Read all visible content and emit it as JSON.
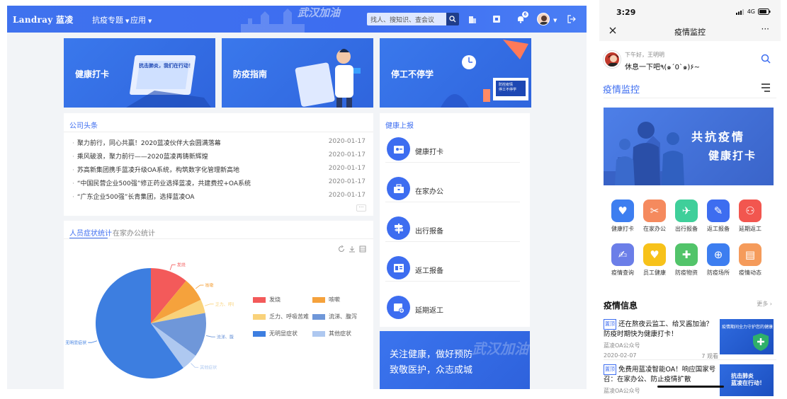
{
  "desktop": {
    "logo": "Landray 蓝凌",
    "nav": [
      {
        "label": "抗疫专题"
      },
      {
        "label": "应用"
      }
    ],
    "banner_art_text": "武汉加油",
    "search": {
      "placeholder": "找人、搜知识、查会议"
    },
    "notification_count": "6",
    "banners": [
      {
        "title": "健康打卡",
        "caption": "抗击肺炎，我们在行动！"
      },
      {
        "title": "防疫指南"
      },
      {
        "title": "停工不停学",
        "caption": "防控疫情\n停工不停学"
      }
    ],
    "news": {
      "title": "公司头条",
      "items": [
        {
          "text": "聚力前行，同心共赢！2020蓝凌伙伴大会圆满落幕",
          "date": "2020-01-17"
        },
        {
          "text": "乘风破浪，聚力前行——2020蓝凌再铸新辉煌",
          "date": "2020-01-17"
        },
        {
          "text": "苏高新集团携手蓝凌升级OA系统，构筑数字化管理新高地",
          "date": "2020-01-17"
        },
        {
          "text": "“中国民营企业500强”修正药业选择蓝凌，共建费控+OA系统",
          "date": "2020-01-17"
        },
        {
          "text": "“广东企业500强”长青集团，选择蓝凌OA",
          "date": "2020-01-17"
        }
      ],
      "more": "···"
    },
    "health_report": {
      "title": "健康上报",
      "items": [
        {
          "label": "健康打卡",
          "icon": "id-card-icon"
        },
        {
          "label": "在家办公",
          "icon": "briefcase-icon"
        },
        {
          "label": "出行报备",
          "icon": "signpost-icon"
        },
        {
          "label": "返工报备",
          "icon": "clipboard-icon"
        },
        {
          "label": "延期返工",
          "icon": "calendar-add-icon"
        }
      ]
    },
    "stats": {
      "tabs": [
        {
          "label": "人员症状统计",
          "active": true
        },
        {
          "label": "在家办公统计",
          "active": false
        }
      ]
    },
    "slogan": {
      "line1": "关注健康，做好预防",
      "line2": "致敬医护，众志成城",
      "ghost": "武汉加油"
    }
  },
  "chart_data": {
    "type": "pie",
    "series": [
      {
        "name": "",
        "slices": [
          {
            "label": "发烧",
            "value": 11,
            "color": "#f35a5a"
          },
          {
            "label": "咳嗽",
            "value": 7,
            "color": "#f5a23c"
          },
          {
            "label": "乏力、呼吸苦难",
            "value": 4,
            "color": "#f9d27a"
          },
          {
            "label": "流涕、腹泻",
            "value": 13,
            "color": "#6f97d9"
          },
          {
            "label": "其他症状",
            "value": 5,
            "color": "#aec8f0"
          },
          {
            "label": "无明显症状",
            "value": 60,
            "color": "#3d7ee0"
          }
        ]
      }
    ],
    "legend_placement": "right"
  },
  "phone": {
    "time": "3:29",
    "network": "4G",
    "title": "疫情监控",
    "greeting_small": "下午好，王明明",
    "greeting": "休息一下吧٩(๑´0`๑)۶~",
    "section": "疫情监控",
    "hero": {
      "line1": "共抗疫情",
      "line2": "健康打卡"
    },
    "apps": [
      {
        "label": "健康打卡",
        "color": "#3d7ef0"
      },
      {
        "label": "在家办公",
        "color": "#f58a5e"
      },
      {
        "label": "出行报备",
        "color": "#3fcf9a"
      },
      {
        "label": "返工报备",
        "color": "#3d6df0"
      },
      {
        "label": "延期返工",
        "color": "#f2564f"
      },
      {
        "label": "疫情查询",
        "color": "#6b7ee8"
      },
      {
        "label": "员工健康",
        "color": "#f7c21a"
      },
      {
        "label": "防疫物资",
        "color": "#52c46a"
      },
      {
        "label": "防疫场所",
        "color": "#3d7ef0"
      },
      {
        "label": "疫情动态",
        "color": "#f59b5b"
      }
    ],
    "info": {
      "title": "疫情信息",
      "more": "更多 ›",
      "articles": [
        {
          "tag": "置顶",
          "title": "还在熬夜云监工、给叉酱加油？防疫时期快为健康打卡！",
          "source": "蓝凌OA公众号",
          "date": "2020-02-07",
          "views": "7 观看",
          "thumb": "疫情期间全力守护您的健康"
        },
        {
          "tag": "置顶",
          "title": "免费用蓝凌智能OA！响应国家号召：在家办公、防止疫情扩散",
          "source": "蓝凌OA公众号",
          "thumb": "抗击肺炎\n蓝凌在行动！"
        }
      ]
    }
  }
}
